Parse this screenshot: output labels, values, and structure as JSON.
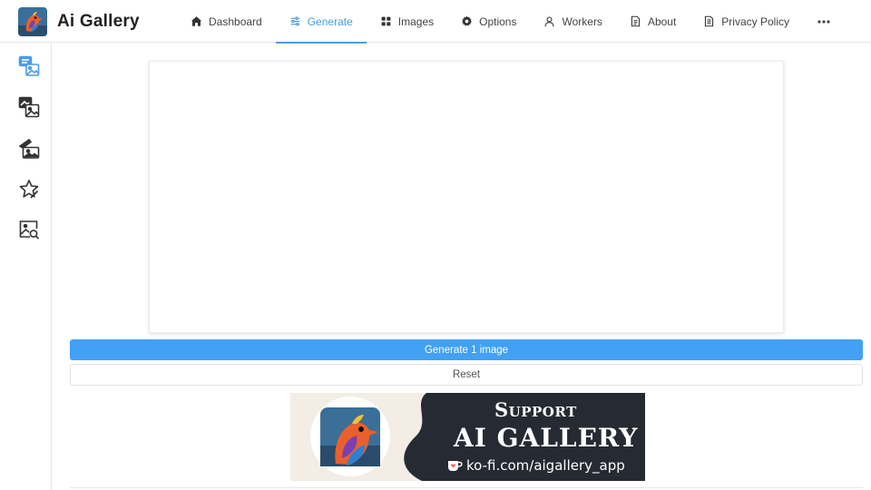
{
  "app": {
    "title": "Ai Gallery",
    "logo": "bird-logo"
  },
  "nav": {
    "items": [
      {
        "label": "Dashboard",
        "icon": "home-icon"
      },
      {
        "label": "Generate",
        "icon": "sliders-icon",
        "active": true
      },
      {
        "label": "Images",
        "icon": "grid-icon"
      },
      {
        "label": "Options",
        "icon": "gear-icon"
      },
      {
        "label": "Workers",
        "icon": "user-icon"
      },
      {
        "label": "About",
        "icon": "document-icon"
      },
      {
        "label": "Privacy Policy",
        "icon": "policy-icon"
      }
    ],
    "more_icon": "more-dots-icon"
  },
  "sidebar": {
    "items": [
      {
        "icon": "text-to-image-icon",
        "active": true
      },
      {
        "icon": "image-to-image-icon"
      },
      {
        "icon": "inpaint-icon"
      },
      {
        "icon": "favorites-icon"
      },
      {
        "icon": "image-search-icon"
      }
    ]
  },
  "actions": {
    "generate_label": "Generate 1 image",
    "reset_label": "Reset"
  },
  "banner": {
    "line1": "Support",
    "line2": "AI GALLERY",
    "line3": "ko-fi.com/aigallery_app"
  },
  "colors": {
    "accent": "#4a9be8",
    "primary_button": "#42a0f5",
    "banner_dark": "#262a33",
    "banner_light": "#f3ede6"
  }
}
